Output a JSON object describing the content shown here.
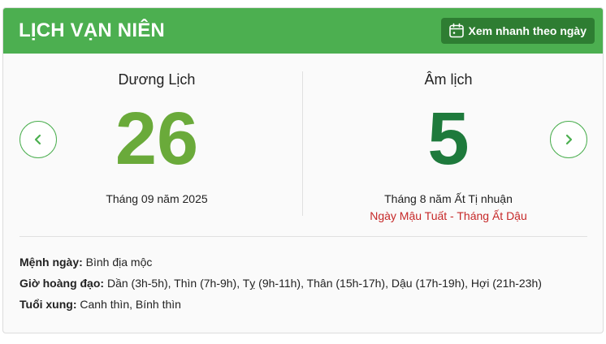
{
  "header": {
    "title": "LỊCH VẠN NIÊN",
    "quick_view_label": "Xem nhanh theo ngày"
  },
  "solar": {
    "heading": "Dương Lịch",
    "day": "26",
    "month_year": "Tháng 09 năm 2025"
  },
  "lunar": {
    "heading": "Âm lịch",
    "day": "5",
    "month_year": "Tháng 8 năm Ất Tị nhuận",
    "can_chi": "Ngày Mậu Tuất - Tháng Ất Dậu"
  },
  "info": {
    "menh_label": "Mệnh ngày:",
    "menh_value": "Bình địa mộc",
    "gio_label": "Giờ hoàng đạo:",
    "gio_value": "Dần (3h-5h), Thìn (7h-9h), Tỵ (9h-11h), Thân (15h-17h), Dậu (17h-19h), Hợi (21h-23h)",
    "tuoi_label": "Tuổi xung:",
    "tuoi_value": "Canh thìn, Bính thìn"
  },
  "icons": {
    "calendar": "calendar-icon",
    "prev": "chevron-left-icon",
    "next": "chevron-right-icon"
  },
  "colors": {
    "header_bg": "#4caf50",
    "button_bg": "#2e7d32",
    "solar_day": "#6aaa3a",
    "lunar_day": "#1e7a3c",
    "can_chi": "#c62828"
  }
}
